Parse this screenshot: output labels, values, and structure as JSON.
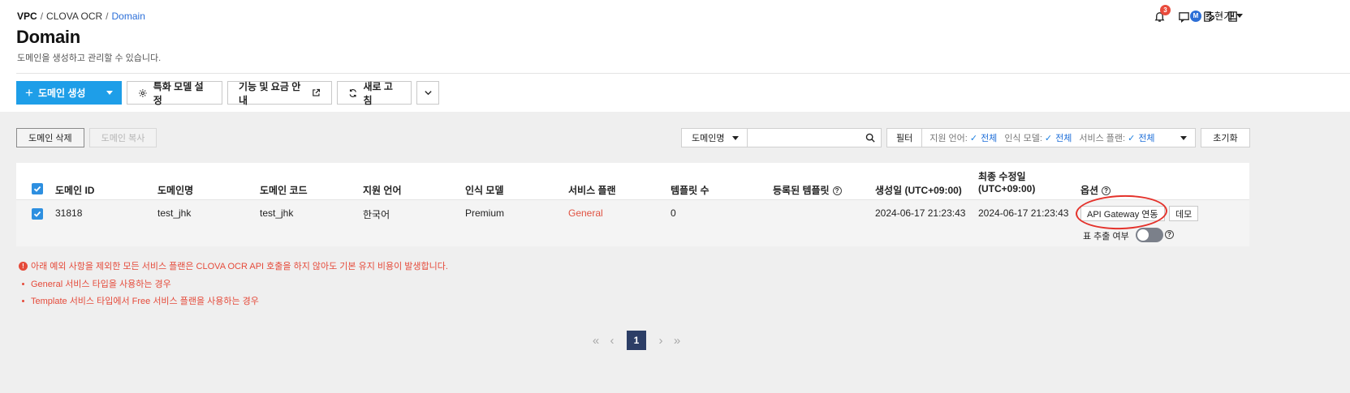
{
  "breadcrumb": {
    "items": [
      "VPC",
      "CLOVA OCR",
      "Domain"
    ]
  },
  "page": {
    "title": "Domain",
    "description": "도메인을 생성하고 관리할 수 있습니다."
  },
  "header": {
    "notification_count": "3",
    "user_initial": "M",
    "user_name": "조현기"
  },
  "toolbar": {
    "create_label": "도메인 생성",
    "specialized_model_label": "특화 모델 설정",
    "pricing_label": "기능 및 요금 안내",
    "refresh_label": "새로 고침"
  },
  "actions": {
    "delete_label": "도메인 삭제",
    "copy_label": "도메인 복사"
  },
  "filter": {
    "search_field": "도메인명",
    "search_value": "",
    "filter_label": "필터",
    "lang_label": "지원 언어:",
    "lang_value": "전체",
    "model_label": "인식 모델:",
    "model_value": "전체",
    "plan_label": "서비스 플랜:",
    "plan_value": "전체",
    "reset_label": "초기화"
  },
  "table": {
    "headers": {
      "domain_id": "도메인 ID",
      "domain_name": "도메인명",
      "domain_code": "도메인 코드",
      "language": "지원 언어",
      "model": "인식 모델",
      "plan": "서비스 플랜",
      "template_count": "템플릿 수",
      "registered_templates": "등록된 템플릿",
      "created": "생성일 (UTC+09:00)",
      "modified_line1": "최종 수정일",
      "modified_line2": "(UTC+09:00)",
      "options": "옵션"
    },
    "rows": [
      {
        "domain_id": "31818",
        "domain_name": "test_jhk",
        "domain_code": "test_jhk",
        "language": "한국어",
        "model": "Premium",
        "plan": "General",
        "template_count": "0",
        "registered_templates": "",
        "created": "2024-06-17 21:23:43",
        "modified": "2024-06-17 21:23:43",
        "api_gateway_label": "API Gateway 연동",
        "demo_label": "데모",
        "table_extract_label": "표 추출 여부",
        "table_extract_on": false
      }
    ]
  },
  "notices": {
    "main": "아래 예외 사항을 제외한 모든 서비스 플랜은 CLOVA OCR API 호출을 하지 않아도 기본 유지 비용이 발생합니다.",
    "items": [
      "General 서비스 타입을 사용하는 경우",
      "Template 서비스 타입에서 Free 서비스 플랜을 사용하는 경우"
    ]
  },
  "pagination": {
    "current": "1"
  },
  "colors": {
    "primary": "#1e9ee8",
    "link": "#2a6ed8",
    "danger": "#e54a3a",
    "page_current": "#2c3e66",
    "annotation": "#e4322b"
  }
}
